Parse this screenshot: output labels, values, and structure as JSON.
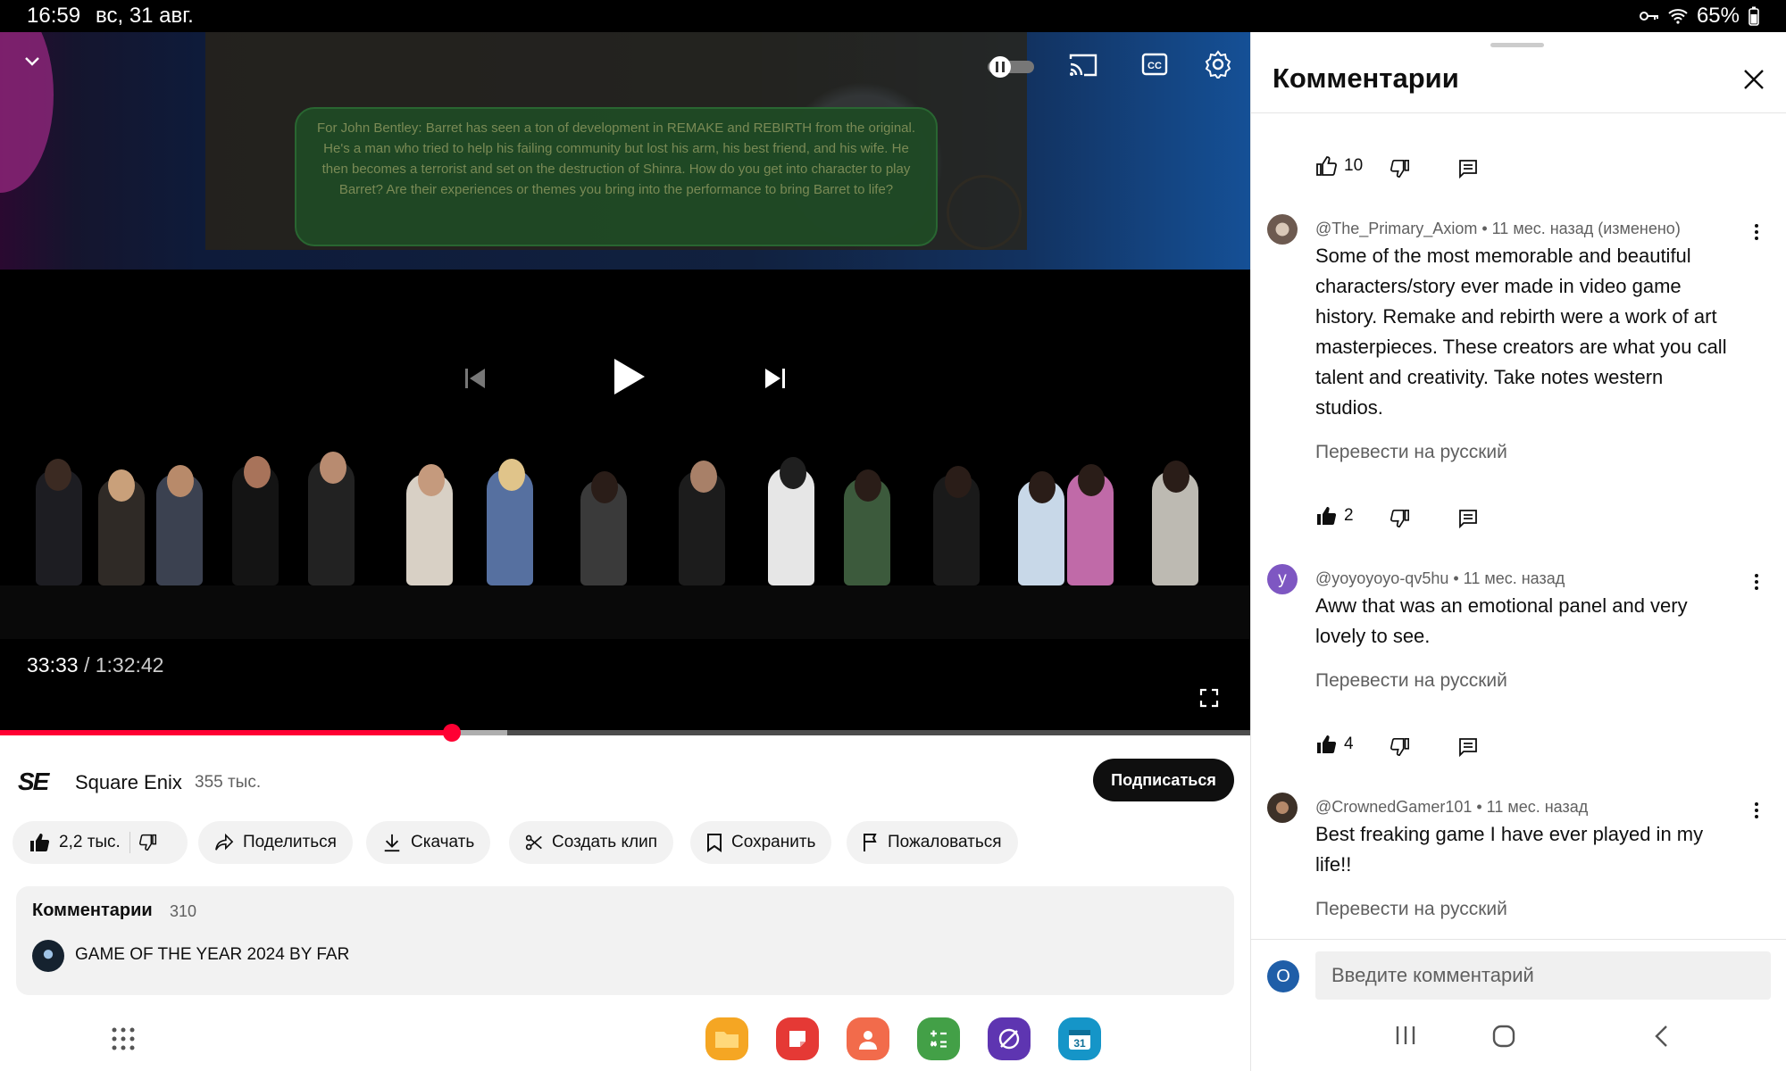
{
  "status_bar": {
    "time": "16:59",
    "date": "вс, 31 авг.",
    "battery": "65%"
  },
  "video": {
    "slide_text": "For John Bentley: Barret has seen a ton of development in REMAKE and REBIRTH from the original. He's a man who tried to help his failing community but lost his arm, his best friend, and his wife. He then becomes a terrorist and set on the destruction of Shinra. How do you get into character to play Barret? Are their experiences or themes you bring into the performance to bring Barret to life?",
    "current_time": "33:33",
    "duration": "1:32:42",
    "time_separator": " / ",
    "progress_fraction": 0.3617,
    "buffered_fraction": 0.406,
    "accent_color": "#ff0033"
  },
  "channel": {
    "logo": "SE",
    "name": "Square Enix",
    "subscribers": "355 тыс.",
    "subscribe_label": "Подписаться"
  },
  "actions": {
    "likes": "2,2 тыс.",
    "share": "Поделиться",
    "download": "Скачать",
    "clip": "Создать клип",
    "save": "Сохранить",
    "report": "Пожаловаться"
  },
  "comments_preview": {
    "title": "Комментарии",
    "count": "310",
    "top_comment": "GAME OF THE YEAR 2024 BY FAR"
  },
  "taskbar": {
    "apps": [
      "folder-icon",
      "notes-icon",
      "contacts-icon",
      "calculator-icon",
      "browser-icon",
      "calendar-icon"
    ],
    "calendar_day": "31"
  },
  "panel": {
    "title": "Комментарии",
    "first_comment_actions": {
      "likes": "10"
    },
    "comments": [
      {
        "author": "@The_Primary_Axiom",
        "meta": " • 11 мес. назад (изменено)",
        "text": "Some of the most memorable and beautiful characters/story ever made in video game history. Remake and rebirth were a work of art masterpieces. These creators are what you call talent and creativity. Take notes western studios.",
        "translate": "Перевести на русский",
        "likes": "2"
      },
      {
        "author": "@yoyoyoyo-qv5hu",
        "meta": " • 11 мес. назад",
        "avatar_letter": "y",
        "text": "Aww that was an emotional panel and very lovely to see.",
        "translate": "Перевести на русский",
        "likes": "4"
      },
      {
        "author": "@CrownedGamer101",
        "meta": " • 11 мес. назад",
        "text": "Best freaking game I have ever played in my life!!",
        "translate": "Перевести на русский"
      }
    ],
    "input_placeholder": "Введите комментарий",
    "my_avatar_letter": "O"
  }
}
